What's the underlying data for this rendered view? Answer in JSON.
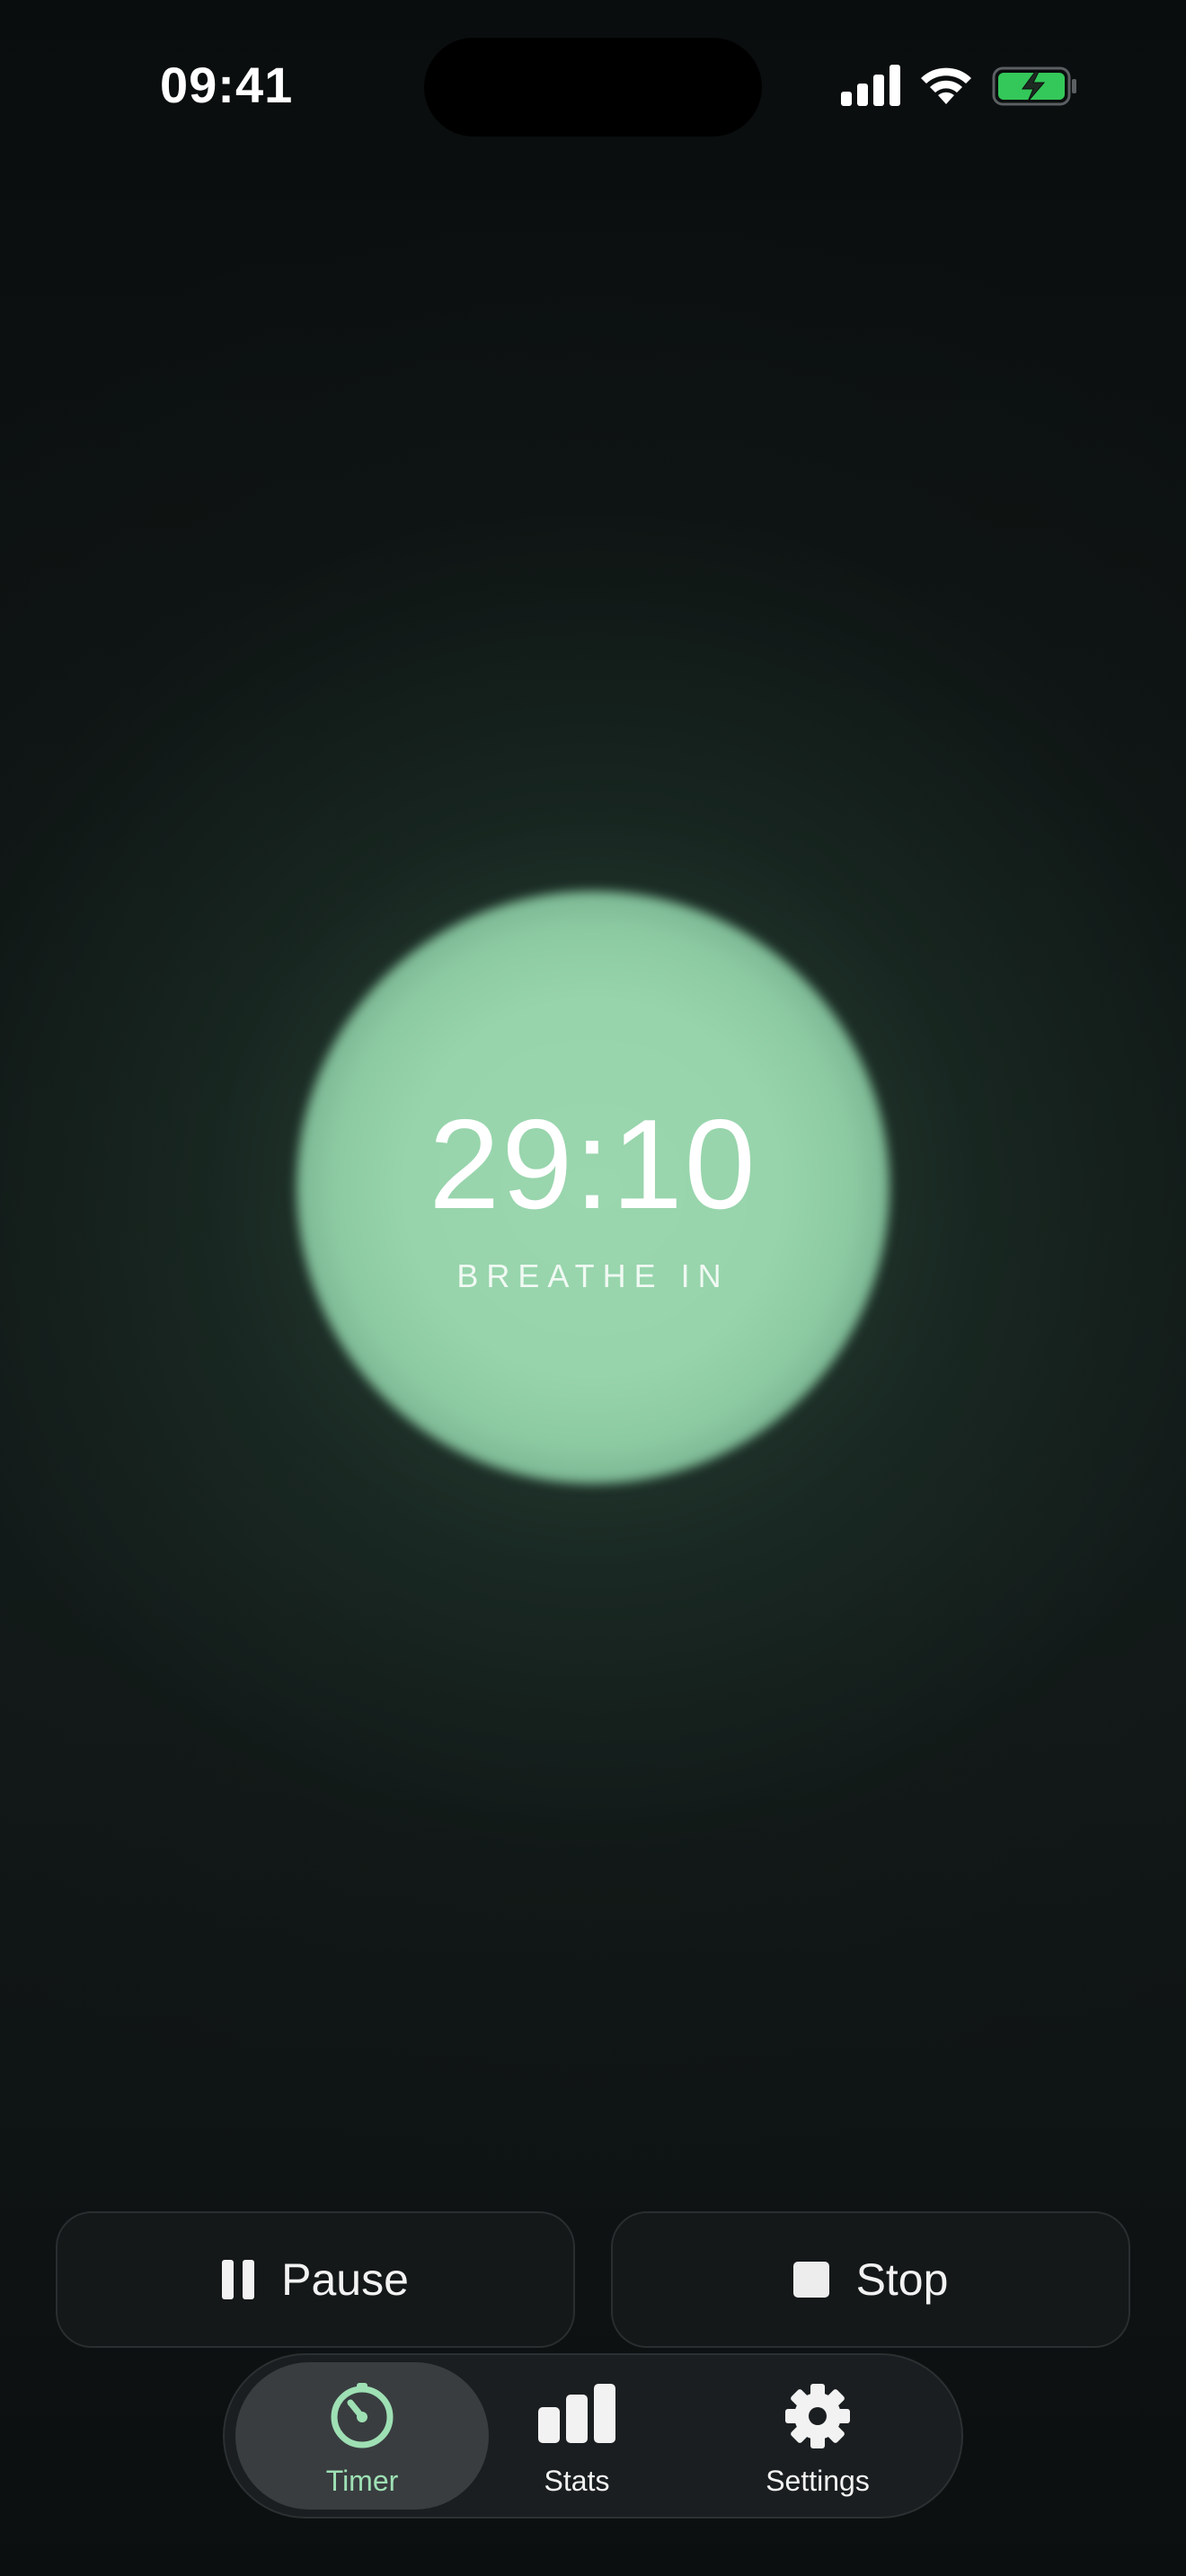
{
  "status_bar": {
    "time": "09:41",
    "icons": [
      "cellular-signal-icon",
      "wifi-icon",
      "battery-charging-icon"
    ]
  },
  "timer": {
    "remaining": "29:10",
    "phase": "BREATHE IN"
  },
  "controls": {
    "pause_label": "Pause",
    "stop_label": "Stop"
  },
  "tabbar": {
    "tabs": [
      {
        "label": "Timer",
        "icon": "timer-icon",
        "selected": true
      },
      {
        "label": "Stats",
        "icon": "bar-chart-icon",
        "selected": false
      },
      {
        "label": "Settings",
        "icon": "gear-icon",
        "selected": false
      }
    ]
  },
  "colors": {
    "accent": "#9ee0b4",
    "orb": "#97d4ab",
    "battery": "#34c759",
    "background": "#0b0e0f"
  }
}
